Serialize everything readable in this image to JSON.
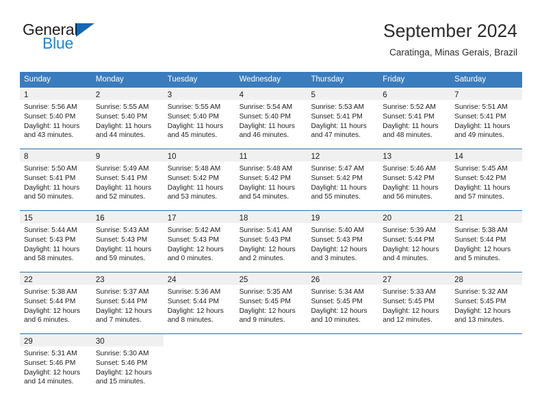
{
  "brand": {
    "line1": "General",
    "line2": "Blue",
    "triangle_color": "#1268b3",
    "blue_color": "#1c86d4"
  },
  "header": {
    "title": "September 2024",
    "subtitle": "Caratinga, Minas Gerais, Brazil"
  },
  "theme": {
    "header_row_bg": "#3a7cbe",
    "header_row_text": "#ffffff",
    "row_divider": "#2e6da4",
    "daynum_band_bg": "#f0f0f0",
    "cell_bg": "#ffffff",
    "text": "#1c1c1c"
  },
  "weekdays": [
    "Sunday",
    "Monday",
    "Tuesday",
    "Wednesday",
    "Thursday",
    "Friday",
    "Saturday"
  ],
  "labels": {
    "sunrise_prefix": "Sunrise:",
    "sunset_prefix": "Sunset:",
    "daylight_prefix": "Daylight:"
  },
  "weeks": [
    [
      {
        "day": "1",
        "sunrise": "Sunrise: 5:56 AM",
        "sunset": "Sunset: 5:40 PM",
        "daylight": "Daylight: 11 hours and 43 minutes."
      },
      {
        "day": "2",
        "sunrise": "Sunrise: 5:55 AM",
        "sunset": "Sunset: 5:40 PM",
        "daylight": "Daylight: 11 hours and 44 minutes."
      },
      {
        "day": "3",
        "sunrise": "Sunrise: 5:55 AM",
        "sunset": "Sunset: 5:40 PM",
        "daylight": "Daylight: 11 hours and 45 minutes."
      },
      {
        "day": "4",
        "sunrise": "Sunrise: 5:54 AM",
        "sunset": "Sunset: 5:40 PM",
        "daylight": "Daylight: 11 hours and 46 minutes."
      },
      {
        "day": "5",
        "sunrise": "Sunrise: 5:53 AM",
        "sunset": "Sunset: 5:41 PM",
        "daylight": "Daylight: 11 hours and 47 minutes."
      },
      {
        "day": "6",
        "sunrise": "Sunrise: 5:52 AM",
        "sunset": "Sunset: 5:41 PM",
        "daylight": "Daylight: 11 hours and 48 minutes."
      },
      {
        "day": "7",
        "sunrise": "Sunrise: 5:51 AM",
        "sunset": "Sunset: 5:41 PM",
        "daylight": "Daylight: 11 hours and 49 minutes."
      }
    ],
    [
      {
        "day": "8",
        "sunrise": "Sunrise: 5:50 AM",
        "sunset": "Sunset: 5:41 PM",
        "daylight": "Daylight: 11 hours and 50 minutes."
      },
      {
        "day": "9",
        "sunrise": "Sunrise: 5:49 AM",
        "sunset": "Sunset: 5:41 PM",
        "daylight": "Daylight: 11 hours and 52 minutes."
      },
      {
        "day": "10",
        "sunrise": "Sunrise: 5:48 AM",
        "sunset": "Sunset: 5:42 PM",
        "daylight": "Daylight: 11 hours and 53 minutes."
      },
      {
        "day": "11",
        "sunrise": "Sunrise: 5:48 AM",
        "sunset": "Sunset: 5:42 PM",
        "daylight": "Daylight: 11 hours and 54 minutes."
      },
      {
        "day": "12",
        "sunrise": "Sunrise: 5:47 AM",
        "sunset": "Sunset: 5:42 PM",
        "daylight": "Daylight: 11 hours and 55 minutes."
      },
      {
        "day": "13",
        "sunrise": "Sunrise: 5:46 AM",
        "sunset": "Sunset: 5:42 PM",
        "daylight": "Daylight: 11 hours and 56 minutes."
      },
      {
        "day": "14",
        "sunrise": "Sunrise: 5:45 AM",
        "sunset": "Sunset: 5:42 PM",
        "daylight": "Daylight: 11 hours and 57 minutes."
      }
    ],
    [
      {
        "day": "15",
        "sunrise": "Sunrise: 5:44 AM",
        "sunset": "Sunset: 5:43 PM",
        "daylight": "Daylight: 11 hours and 58 minutes."
      },
      {
        "day": "16",
        "sunrise": "Sunrise: 5:43 AM",
        "sunset": "Sunset: 5:43 PM",
        "daylight": "Daylight: 11 hours and 59 minutes."
      },
      {
        "day": "17",
        "sunrise": "Sunrise: 5:42 AM",
        "sunset": "Sunset: 5:43 PM",
        "daylight": "Daylight: 12 hours and 0 minutes."
      },
      {
        "day": "18",
        "sunrise": "Sunrise: 5:41 AM",
        "sunset": "Sunset: 5:43 PM",
        "daylight": "Daylight: 12 hours and 2 minutes."
      },
      {
        "day": "19",
        "sunrise": "Sunrise: 5:40 AM",
        "sunset": "Sunset: 5:43 PM",
        "daylight": "Daylight: 12 hours and 3 minutes."
      },
      {
        "day": "20",
        "sunrise": "Sunrise: 5:39 AM",
        "sunset": "Sunset: 5:44 PM",
        "daylight": "Daylight: 12 hours and 4 minutes."
      },
      {
        "day": "21",
        "sunrise": "Sunrise: 5:38 AM",
        "sunset": "Sunset: 5:44 PM",
        "daylight": "Daylight: 12 hours and 5 minutes."
      }
    ],
    [
      {
        "day": "22",
        "sunrise": "Sunrise: 5:38 AM",
        "sunset": "Sunset: 5:44 PM",
        "daylight": "Daylight: 12 hours and 6 minutes."
      },
      {
        "day": "23",
        "sunrise": "Sunrise: 5:37 AM",
        "sunset": "Sunset: 5:44 PM",
        "daylight": "Daylight: 12 hours and 7 minutes."
      },
      {
        "day": "24",
        "sunrise": "Sunrise: 5:36 AM",
        "sunset": "Sunset: 5:44 PM",
        "daylight": "Daylight: 12 hours and 8 minutes."
      },
      {
        "day": "25",
        "sunrise": "Sunrise: 5:35 AM",
        "sunset": "Sunset: 5:45 PM",
        "daylight": "Daylight: 12 hours and 9 minutes."
      },
      {
        "day": "26",
        "sunrise": "Sunrise: 5:34 AM",
        "sunset": "Sunset: 5:45 PM",
        "daylight": "Daylight: 12 hours and 10 minutes."
      },
      {
        "day": "27",
        "sunrise": "Sunrise: 5:33 AM",
        "sunset": "Sunset: 5:45 PM",
        "daylight": "Daylight: 12 hours and 12 minutes."
      },
      {
        "day": "28",
        "sunrise": "Sunrise: 5:32 AM",
        "sunset": "Sunset: 5:45 PM",
        "daylight": "Daylight: 12 hours and 13 minutes."
      }
    ],
    [
      {
        "day": "29",
        "sunrise": "Sunrise: 5:31 AM",
        "sunset": "Sunset: 5:46 PM",
        "daylight": "Daylight: 12 hours and 14 minutes."
      },
      {
        "day": "30",
        "sunrise": "Sunrise: 5:30 AM",
        "sunset": "Sunset: 5:46 PM",
        "daylight": "Daylight: 12 hours and 15 minutes."
      },
      {
        "day": "",
        "sunrise": "",
        "sunset": "",
        "daylight": ""
      },
      {
        "day": "",
        "sunrise": "",
        "sunset": "",
        "daylight": ""
      },
      {
        "day": "",
        "sunrise": "",
        "sunset": "",
        "daylight": ""
      },
      {
        "day": "",
        "sunrise": "",
        "sunset": "",
        "daylight": ""
      },
      {
        "day": "",
        "sunrise": "",
        "sunset": "",
        "daylight": ""
      }
    ]
  ]
}
